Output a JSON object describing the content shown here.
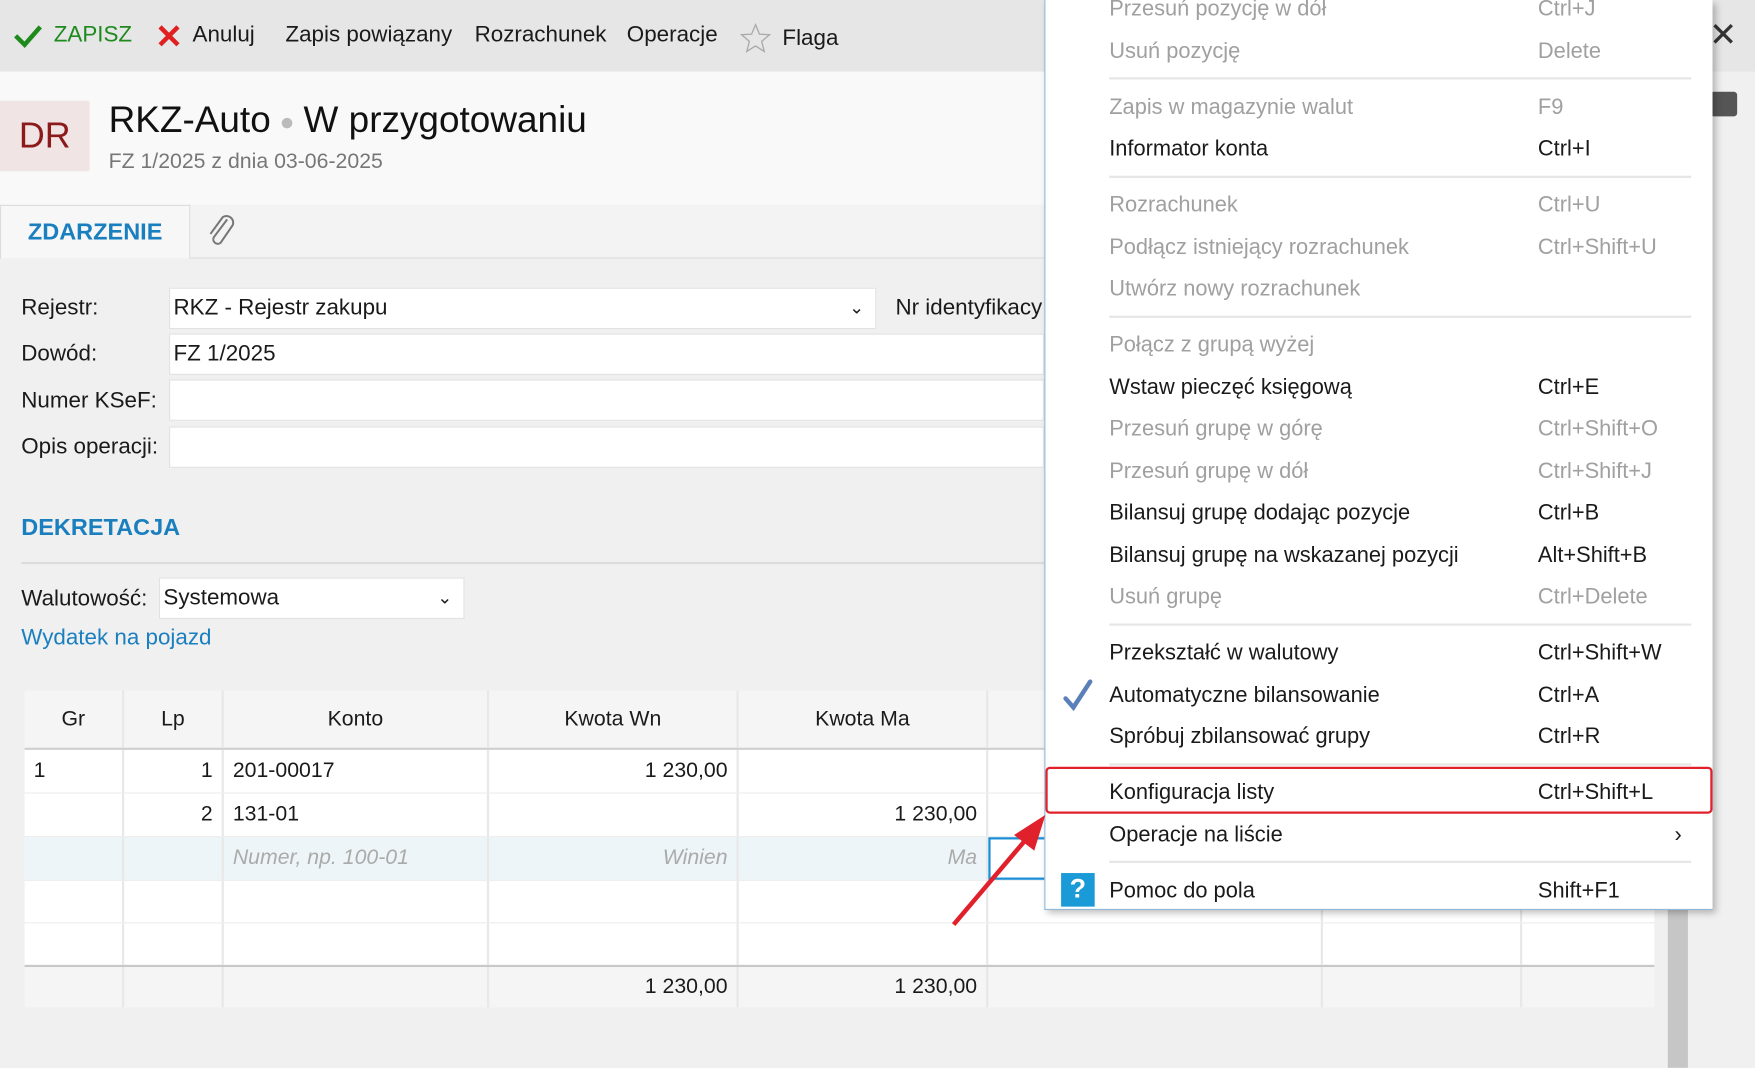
{
  "toolbar": {
    "save": "ZAPISZ",
    "cancel": "Anuluj",
    "linked": "Zapis powiązany",
    "settlement": "Rozrachunek",
    "operations": "Operacje",
    "flag": "Flaga"
  },
  "header": {
    "badge": "DR",
    "name": "RKZ-Auto",
    "status": "W przygotowaniu",
    "subtitle": "FZ 1/2025 z dnia 03-06-2025"
  },
  "tabs": {
    "event": "ZDARZENIE"
  },
  "form": {
    "register_label": "Rejestr:",
    "register_value": "RKZ - Rejestr zakupu",
    "id_label": "Nr identyfikacy",
    "doc_label": "Dowód:",
    "doc_value": "FZ 1/2025",
    "ksef_label": "Numer KSeF:",
    "ksef_value": "",
    "desc_label": "Opis operacji:",
    "desc_value": ""
  },
  "posting": {
    "section": "DEKRETACJA",
    "currency_label": "Walutowość:",
    "currency_value": "Systemowa",
    "link": "Wydatek na pojazd"
  },
  "table": {
    "headers": [
      "Gr",
      "Lp",
      "Konto",
      "Kwota Wn",
      "Kwota Ma"
    ],
    "rows": [
      [
        "1",
        "1",
        "201-00017",
        "1 230,00",
        ""
      ],
      [
        "",
        "2",
        "131-01",
        "",
        "1 230,00"
      ]
    ],
    "placeholders": {
      "konto": "Numer, np. 100-01",
      "wn": "Winien",
      "ma": "Ma"
    },
    "totals": {
      "wn": "1 230,00",
      "ma": "1 230,00"
    }
  },
  "menu": [
    {
      "label": "Przesuń pozycję w dół",
      "shortcut": "Ctrl+J",
      "disabled": true
    },
    {
      "label": "Usuń pozycję",
      "shortcut": "Delete",
      "disabled": true
    },
    {
      "sep": true
    },
    {
      "label": "Zapis w magazynie walut",
      "shortcut": "F9",
      "disabled": true
    },
    {
      "label": "Informator konta",
      "shortcut": "Ctrl+I"
    },
    {
      "sep": true
    },
    {
      "label": "Rozrachunek",
      "shortcut": "Ctrl+U",
      "disabled": true
    },
    {
      "label": "Podłącz istniejący rozrachunek",
      "shortcut": "Ctrl+Shift+U",
      "disabled": true
    },
    {
      "label": "Utwórz nowy rozrachunek",
      "shortcut": "",
      "disabled": true
    },
    {
      "sep": true
    },
    {
      "label": "Połącz z grupą wyżej",
      "shortcut": "",
      "disabled": true
    },
    {
      "label": "Wstaw pieczęć księgową",
      "shortcut": "Ctrl+E"
    },
    {
      "label": "Przesuń grupę w górę",
      "shortcut": "Ctrl+Shift+O",
      "disabled": true
    },
    {
      "label": "Przesuń grupę w dół",
      "shortcut": "Ctrl+Shift+J",
      "disabled": true
    },
    {
      "label": "Bilansuj grupę dodając pozycje",
      "shortcut": "Ctrl+B"
    },
    {
      "label": "Bilansuj grupę na wskazanej pozycji",
      "shortcut": "Alt+Shift+B"
    },
    {
      "label": "Usuń grupę",
      "shortcut": "Ctrl+Delete",
      "disabled": true
    },
    {
      "sep": true
    },
    {
      "label": "Przekształć w walutowy",
      "shortcut": "Ctrl+Shift+W"
    },
    {
      "label": "Automatyczne bilansowanie",
      "shortcut": "Ctrl+A",
      "checked": true
    },
    {
      "label": "Spróbuj zbilansować grupy",
      "shortcut": "Ctrl+R"
    },
    {
      "sep": true
    },
    {
      "label": "Konfiguracja listy",
      "shortcut": "Ctrl+Shift+L",
      "highlighted": true
    },
    {
      "label": "Operacje na liście",
      "shortcut": "",
      "submenu": true
    },
    {
      "sep": true
    },
    {
      "label": "Pomoc do pola",
      "shortcut": "Shift+F1",
      "help": true
    }
  ],
  "colors": {
    "accent": "#1a7fbf",
    "save": "#1e8a1e",
    "cancel": "#e02020",
    "highlight": "#e0202a"
  }
}
